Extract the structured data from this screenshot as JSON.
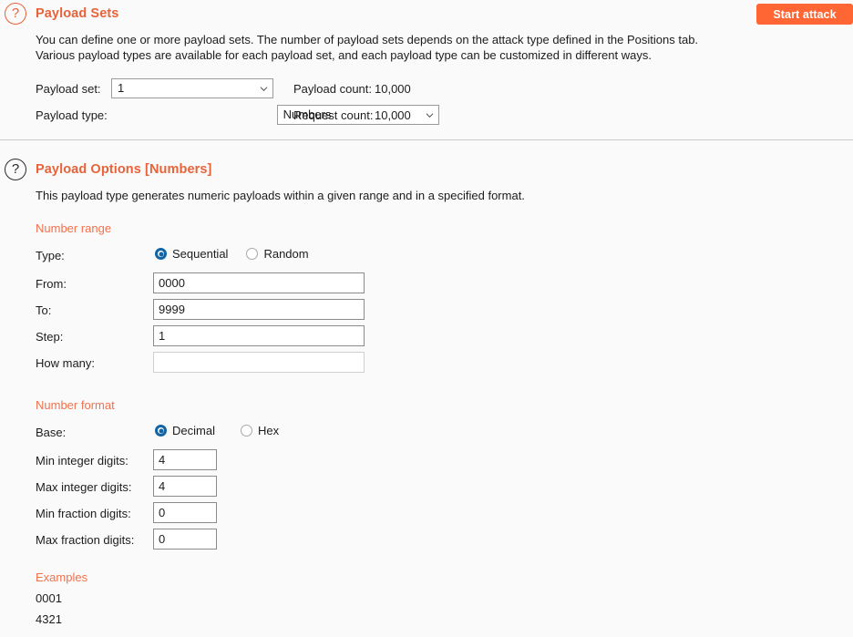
{
  "toolbar": {
    "start_attack_label": "Start attack"
  },
  "payload_sets": {
    "help_icon": "question-mark-icon",
    "title": "Payload Sets",
    "description_line1": "You can define one or more payload sets. The number of payload sets depends on the attack type defined in the Positions tab.",
    "description_line2": "Various payload types are available for each payload set, and each payload type can be customized in different ways.",
    "payload_set_label": "Payload set:",
    "payload_set_value": "1",
    "payload_set_options": [
      "1"
    ],
    "payload_type_label": "Payload type:",
    "payload_type_value": "Numbers",
    "payload_type_options": [
      "Numbers"
    ],
    "payload_count_label": "Payload count:",
    "payload_count_value": "10,000",
    "request_count_label": "Request count:",
    "request_count_value": "10,000"
  },
  "payload_options": {
    "help_icon": "question-mark-icon",
    "title": "Payload Options [Numbers]",
    "description": "This payload type generates numeric payloads within a given range and in a specified format.",
    "number_range": {
      "heading": "Number range",
      "type_label": "Type:",
      "type_options": [
        {
          "label": "Sequential",
          "selected": true
        },
        {
          "label": "Random",
          "selected": false
        }
      ],
      "from_label": "From:",
      "from_value": "0000",
      "to_label": "To:",
      "to_value": "9999",
      "step_label": "Step:",
      "step_value": "1",
      "how_many_label": "How many:",
      "how_many_value": "",
      "how_many_placeholder": ""
    },
    "number_format": {
      "heading": "Number format",
      "base_label": "Base:",
      "base_options": [
        {
          "label": "Decimal",
          "selected": true
        },
        {
          "label": "Hex",
          "selected": false
        }
      ],
      "min_integer_label": "Min integer digits:",
      "min_integer_value": "4",
      "max_integer_label": "Max integer digits:",
      "max_integer_value": "4",
      "min_fraction_label": "Min fraction digits:",
      "min_fraction_value": "0",
      "max_fraction_label": "Max fraction digits:",
      "max_fraction_value": "0"
    },
    "examples": {
      "heading": "Examples",
      "values": [
        "0001",
        "4321"
      ]
    }
  },
  "colors": {
    "accent_orange": "#e8633a",
    "button_orange": "#ff6633",
    "subheading_orange": "#f2714d",
    "radio_blue": "#1364a5",
    "background": "#fafafa"
  }
}
